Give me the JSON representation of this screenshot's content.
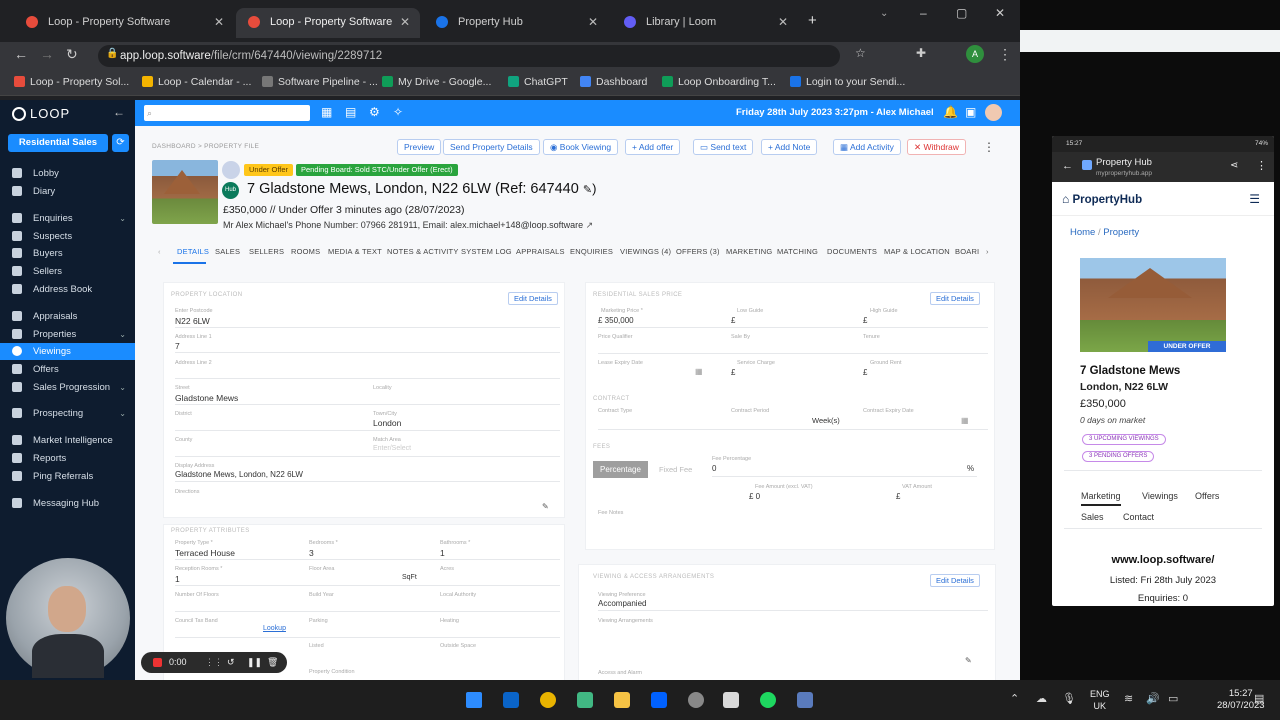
{
  "browser": {
    "tabs": [
      {
        "label": "Loop - Property Software",
        "color": "#e74c3c"
      },
      {
        "label": "Loop - Property Software",
        "color": "#e74c3c"
      },
      {
        "label": "Property Hub",
        "color": "#1a73e8"
      },
      {
        "label": "Library | Loom",
        "color": "#625df5"
      }
    ],
    "url_host": "app.loop.software",
    "url_path": "/file/crm/647440/viewing/2289712",
    "bookmarks": [
      "Loop - Property Sol...",
      "Loop - Calendar - ...",
      "Software Pipeline - ...",
      "My Drive - Google...",
      "ChatGPT",
      "Dashboard",
      "Loop Onboarding T...",
      "Login to your Sendi..."
    ]
  },
  "sidebar": {
    "logo": "LOOP",
    "scope_button": "Residential Sales",
    "items": [
      {
        "label": "Lobby"
      },
      {
        "label": "Diary"
      },
      {
        "label": "Enquiries",
        "chev": "⌄"
      },
      {
        "label": "Suspects"
      },
      {
        "label": "Buyers"
      },
      {
        "label": "Sellers"
      },
      {
        "label": "Address Book"
      },
      {
        "label": "Appraisals"
      },
      {
        "label": "Properties",
        "chev": "⌄"
      },
      {
        "label": "Viewings"
      },
      {
        "label": "Offers"
      },
      {
        "label": "Sales Progression",
        "chev": "⌄"
      },
      {
        "label": "Prospecting",
        "chev": "⌄"
      },
      {
        "label": "Market Intelligence"
      },
      {
        "label": "Reports"
      },
      {
        "label": "Ping Referrals"
      },
      {
        "label": "Messaging Hub"
      }
    ]
  },
  "header": {
    "date_user": "Friday 28th July 2023 3:27pm - Alex Michael"
  },
  "property": {
    "breadcrumb": "DASHBOARD  >  PROPERTY FILE",
    "actions": [
      "Preview",
      "Send Property Details",
      "Book Viewing",
      "Add offer",
      "Send text",
      "Add Note",
      "Add Activity",
      "Withdraw"
    ],
    "badge_status": "Under Offer",
    "badge_board": "Pending Board: Sold STC/Under Offer (Erect)",
    "hub": "Hub",
    "title": "7 Gladstone Mews, London, N22 6LW (Ref: 647440",
    "status_line": "£350,000  //  Under Offer 3 minutes ago (28/07/2023)",
    "contact": "Mr Alex Michael's Phone Number: 07966 281911, Email: alex.michael+148@loop.software",
    "tabs": [
      "DETAILS",
      "SALES",
      "SELLERS",
      "ROOMS",
      "MEDIA & TEXT",
      "NOTES & ACTIVITY",
      "SYSTEM LOG",
      "APPRAISALS",
      "ENQUIRIES",
      "VIEWINGS (4)",
      "OFFERS (3)",
      "MARKETING",
      "MATCHING",
      "DOCUMENTS",
      "MAP & LOCATION",
      "BOARI"
    ]
  },
  "location": {
    "section": "PROPERTY LOCATION",
    "edit": "Edit Details",
    "postcode_label": "Enter Postcode",
    "postcode": "N22 6LW",
    "line1_label": "Address Line 1",
    "line1": "7",
    "line2_label": "Address Line 2",
    "street_label": "Street",
    "street": "Gladstone Mews",
    "locality_label": "Locality",
    "district_label": "District",
    "town_label": "Town/City",
    "town": "London",
    "county_label": "County",
    "match_label": "Match Area",
    "match": "Enter/Select",
    "display_label": "Display Address",
    "display": "Gladstone Mews, London, N22 6LW",
    "directions_label": "Directions"
  },
  "attributes": {
    "section": "PROPERTY ATTRIBUTES",
    "type_label": "Property Type *",
    "type": "Terraced House",
    "bed_label": "Bedrooms *",
    "bed": "3",
    "bath_label": "Bathrooms *",
    "bath": "1",
    "recep_label": "Reception Rooms *",
    "recep": "1",
    "floor_label": "Floor Area",
    "floor_unit": "SqFt",
    "acres_label": "Acres",
    "floors_label": "Number Of Floors",
    "built_label": "Build Year",
    "la_label": "Local Authority",
    "tax_label": "Council Tax Band",
    "lookup": "Lookup",
    "parking_label": "Parking",
    "heating_label": "Heating",
    "listed_label": "Listed",
    "outside_label": "Outside Space",
    "condition_label": "Property Condition"
  },
  "financial": {
    "section": "RESIDENTIAL SALES PRICE",
    "edit": "Edit Details",
    "price_label": "Marketing Price *",
    "price": "£ 350,000",
    "low_label": "Low Guide",
    "low": "£",
    "high_label": "High Guide",
    "high": "£",
    "qual_label": "Price Qualifier",
    "sale_label": "Sale By",
    "tenure_label": "Tenure",
    "lease_label": "Lease Expiry Date",
    "service_label": "Service Charge",
    "service": "£",
    "ground_label": "Ground Rent",
    "ground": "£",
    "contract_section": "CONTRACT",
    "ctype_label": "Contract Type",
    "cperiod_label": "Contract Period",
    "cperiod_unit": "Week(s)",
    "cexpiry_label": "Contract Expiry Date",
    "fees_section": "FEES",
    "pct_button": "Percentage",
    "fixed_button": "Fixed Fee",
    "feepct_label": "Fee Percentage",
    "feepct": "0",
    "pct_sign": "%",
    "feeex_label": "Fee Amount (excl. VAT)",
    "feeex": "£ 0",
    "vat_label": "VAT Amount",
    "vat": "£",
    "notes_label": "Fee Notes"
  },
  "viewing": {
    "section": "VIEWING & ACCESS ARRANGEMENTS",
    "edit": "Edit Details",
    "pref_label": "Viewing Preference",
    "pref": "Accompanied",
    "arr_label": "Viewing Arrangements",
    "alarm_label": "Access and Alarm"
  },
  "phone": {
    "status": "15:27",
    "battery": "74%",
    "bar_title": "Property Hub",
    "bar_url": "mypropertyhub.app",
    "logo": "PropertyHub",
    "crumb_home": "Home",
    "crumb_sep": "/",
    "crumb_current": "Property",
    "flag": "UNDER OFFER",
    "addr1": "7 Gladstone Mews",
    "addr2": "London, N22 6LW",
    "price": "£350,000",
    "days": "0 days on market",
    "pill1": "3 UPCOMING VIEWINGS",
    "pill2": "3 PENDING OFFERS",
    "tabs": [
      "Marketing",
      "Viewings",
      "Offers",
      "Sales",
      "Contact"
    ],
    "web": "www.loop.software/",
    "listed": "Listed: Fri 28th July 2023",
    "enquiries": "Enquiries: 0"
  },
  "recorder": {
    "time": "0:00"
  },
  "taskbar": {
    "lang1": "ENG",
    "lang2": "UK",
    "time": "15:27",
    "date": "28/07/2023"
  }
}
